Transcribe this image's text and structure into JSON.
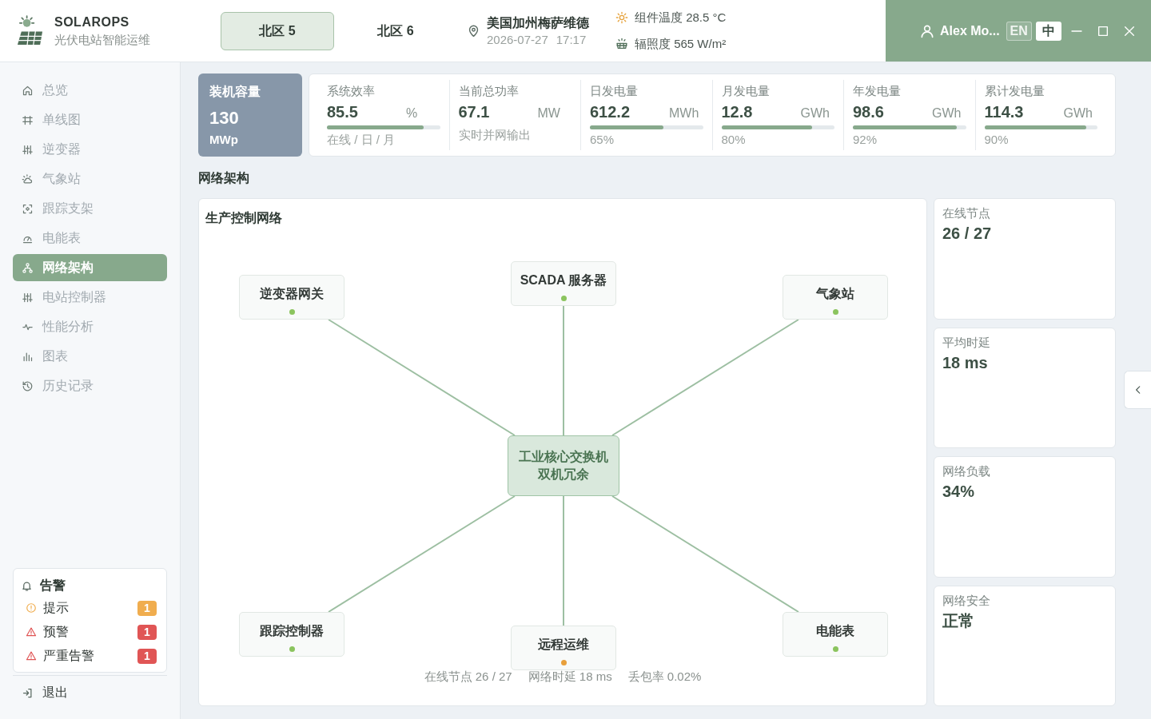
{
  "header": {
    "brand": {
      "name": "SOLAROPS",
      "subtitle": "光伏电站智能运维"
    },
    "tabs": [
      {
        "label": "北区 5",
        "selected": true
      },
      {
        "label": "北区 6",
        "selected": false
      }
    ],
    "location": {
      "place": "美国加州梅萨维德",
      "date": "2026-07-27",
      "time": "17:17"
    },
    "conditions": [
      {
        "label": "组件温度 28.5 °C"
      },
      {
        "label": "辐照度 565 W/m²"
      }
    ],
    "user": {
      "name": "Alex Mo..."
    },
    "languages": [
      {
        "label": "EN",
        "selected": false
      },
      {
        "label": "中",
        "selected": true
      }
    ]
  },
  "sidebar": {
    "nav": [
      {
        "label": "总览",
        "selected": false
      },
      {
        "label": "单线图",
        "selected": false
      },
      {
        "label": "逆变器",
        "selected": false
      },
      {
        "label": "气象站",
        "selected": false
      },
      {
        "label": "跟踪支架",
        "selected": false
      },
      {
        "label": "电能表",
        "selected": false
      },
      {
        "label": "网络架构",
        "selected": true
      },
      {
        "label": "电站控制器",
        "selected": false
      },
      {
        "label": "性能分析",
        "selected": false
      },
      {
        "label": "图表",
        "selected": false
      },
      {
        "label": "历史记录",
        "selected": false
      }
    ],
    "alerts": {
      "title": "告警",
      "items": [
        {
          "kind": "notice",
          "label": "提示",
          "count": "1",
          "color": "#f0ad4e"
        },
        {
          "kind": "warning",
          "label": "预警",
          "count": "1",
          "color": "#e05555"
        },
        {
          "kind": "critical",
          "label": "严重告警",
          "count": "1",
          "color": "#e05555"
        }
      ]
    },
    "logout": "退出"
  },
  "capacity": {
    "label": "装机容量",
    "value": "130",
    "unit": "MWp"
  },
  "kpis": [
    {
      "label": "系统效率",
      "value": "85.5",
      "unit": "%",
      "level": 0.855,
      "caption": "在线 / 日 / 月"
    },
    {
      "label": "当前总功率",
      "value": "67.1",
      "unit": "MW",
      "caption": "实时并网输出"
    },
    {
      "label": "日发电量",
      "value": "612.2",
      "unit": "MWh",
      "level": 0.65,
      "caption": "65%"
    },
    {
      "label": "月发电量",
      "value": "12.8",
      "unit": "GWh",
      "level": 0.8,
      "caption": "80%"
    },
    {
      "label": "年发电量",
      "value": "98.6",
      "unit": "GWh",
      "level": 0.92,
      "caption": "92%"
    },
    {
      "label": "累计发电量",
      "value": "114.3",
      "unit": "GWh",
      "level": 0.9,
      "caption": "90%"
    }
  ],
  "section_title": "网络架构",
  "network": {
    "title": "生产控制网络",
    "nodes": [
      {
        "kind": "device",
        "label": "逆变器网关",
        "color": "#8bc45e"
      },
      {
        "kind": "device",
        "label": "SCADA 服务器",
        "color": "#8bc45e"
      },
      {
        "kind": "device",
        "label": "气象站",
        "color": "#8bc45e"
      },
      {
        "kind": "hub",
        "label_lines": [
          "工业核心交换机",
          "双机冗余"
        ]
      },
      {
        "kind": "device",
        "label": "跟踪控制器",
        "color": "#8bc45e"
      },
      {
        "kind": "device",
        "label": "远程运维",
        "color": "#e8a03c"
      },
      {
        "kind": "device",
        "label": "电能表",
        "color": "#8bc45e"
      }
    ],
    "stats": [
      "在线节点 26 / 27",
      "网络时延 18 ms",
      "丢包率 0.02%"
    ]
  },
  "summary_cards": [
    {
      "label": "在线节点",
      "value": "26 / 27"
    },
    {
      "label": "平均时延",
      "value": "18 ms"
    },
    {
      "label": "网络负载",
      "value": "34%"
    },
    {
      "label": "网络安全",
      "value": "正常"
    }
  ]
}
